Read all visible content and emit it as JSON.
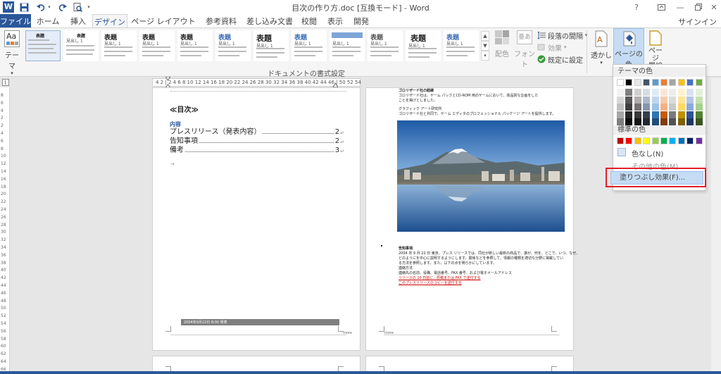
{
  "window": {
    "title": "目次の作り方.doc [互換モード] - Word",
    "help": "?",
    "min": "—",
    "max": "□",
    "close": "✕"
  },
  "tabs": {
    "file": "ファイル",
    "home": "ホーム",
    "insert": "挿入",
    "design": "デザイン",
    "layout": "ページ レイアウト",
    "references": "参考資料",
    "mailings": "差し込み文書",
    "review": "校閲",
    "view": "表示",
    "developer": "開発",
    "signin": "サインイン"
  },
  "ribbon": {
    "theme_label": "テーマ",
    "gallery_heading_jp": "表題",
    "gallery_heading1": "見出し 1",
    "gallery_item_title": "表題",
    "colors_label": "配色",
    "fonts_label": "フォント",
    "font_icon_text": "亜あ",
    "paragraph_spacing": "段落の間隔",
    "effects": "効果",
    "set_default": "既定に設定",
    "watermark": "透かし",
    "page_color": "ページの色",
    "page_borders": "ページ\n罫線",
    "group_document_format": "ドキュメントの書式設定",
    "theme_icon_text": "Aa"
  },
  "ruler": {
    "numbers": "4 2 | 2 4 6 8 10 12 14 16 18 20 22 24 26 28 30 32 34 36 38 40 42 44 46 | 50 52 54",
    "vertical": [
      "8",
      "6",
      "4",
      "2",
      "2",
      "4",
      "6",
      "8",
      "10",
      "12",
      "14",
      "16",
      "18",
      "20",
      "22",
      "24",
      "26",
      "28",
      "30",
      "32",
      "34",
      "36",
      "38",
      "40",
      "42",
      "44",
      "46",
      "48",
      "50",
      "52",
      "54",
      "56",
      "58",
      "60",
      "62",
      "64",
      "66"
    ]
  },
  "page1": {
    "toc_title": "≪目次≫",
    "toc_heading": "内容",
    "toc_items": [
      {
        "label": "プレスリリース（発表内容）",
        "page": "2"
      },
      {
        "label": "告知事項",
        "page": "2"
      },
      {
        "label": "備考",
        "page": "3"
      }
    ],
    "footer_band": "2004年9月22日 8:00 発表",
    "footer_right": "more"
  },
  "page2": {
    "section1_title": "ゴロリザード社の経緯",
    "section1_body": "ゴロリザード社は、ゲーム パックとCD-ROM 用のゲームにおいて、高品質な企画をしたことを掲げとしました。",
    "section2_title": "グラフィック アート研究所",
    "section2_body": "ゴロリザード社と共同で、ゲーム エディタのプロフェッショナル パッケージ アートを提供します。",
    "notice_title": "告知事項",
    "notice_lines": [
      "2004 年 9 月 22 日 東京、プレス リリースでは、同社が新しい最新の商品で、誰が、何を、どこで、いつ、なぜ、",
      "どのようにを中心に説明するようにします。関係などを参照して、情報の種類を適切な分野に掲載してい",
      "る方法を参照します。また、以下の点を明らかにしています。",
      "連絡方法",
      "連絡先の名前、役職、電話番号、FAX 番号、および電子メールアドレス"
    ],
    "notice_red_lines": [
      "リリースの 10 日前に、原稿または FAX で送付する",
      "このプレスリリースのコピーを送付する"
    ],
    "footer_left": "more"
  },
  "color_menu": {
    "theme_colors_header": "テーマの色",
    "standard_colors_header": "標準の色",
    "no_color": "色なし(N)",
    "more_colors": "その他の色(M)...",
    "fill_effects": "塗りつぶし効果(F)...",
    "theme_top_row": [
      "#ffffff",
      "#000000",
      "#e7e6e6",
      "#44546a",
      "#5b9bd5",
      "#ed7d31",
      "#a5a5a5",
      "#ffc000",
      "#4472c4",
      "#70ad47"
    ],
    "theme_shades": [
      [
        "#f2f2f2",
        "#7f7f7f",
        "#d0cece",
        "#d6dce4",
        "#deebf6",
        "#fbe5d5",
        "#ededed",
        "#fff2cc",
        "#d9e2f3",
        "#e2efd9"
      ],
      [
        "#d8d8d8",
        "#595959",
        "#aeabab",
        "#adb9ca",
        "#bdd7ee",
        "#f7cbac",
        "#dbdbdb",
        "#fee599",
        "#b4c6e7",
        "#c5e0b3"
      ],
      [
        "#bfbfbf",
        "#3f3f3f",
        "#757070",
        "#8496b0",
        "#9cc3e5",
        "#f4b183",
        "#c9c9c9",
        "#ffd965",
        "#8eaadb",
        "#a8d08d"
      ],
      [
        "#a5a5a5",
        "#262626",
        "#3a3838",
        "#323f4f",
        "#2e75b5",
        "#c55a11",
        "#7b7b7b",
        "#bf9000",
        "#2f5496",
        "#538135"
      ],
      [
        "#7f7f7f",
        "#0c0c0c",
        "#171616",
        "#222a35",
        "#1e4e79",
        "#833c0b",
        "#525252",
        "#7f6000",
        "#1f3864",
        "#375623"
      ]
    ],
    "standard": [
      "#c00000",
      "#ff0000",
      "#ffc000",
      "#ffff00",
      "#92d050",
      "#00b050",
      "#00b0f0",
      "#0070c0",
      "#002060",
      "#7030a0"
    ]
  }
}
